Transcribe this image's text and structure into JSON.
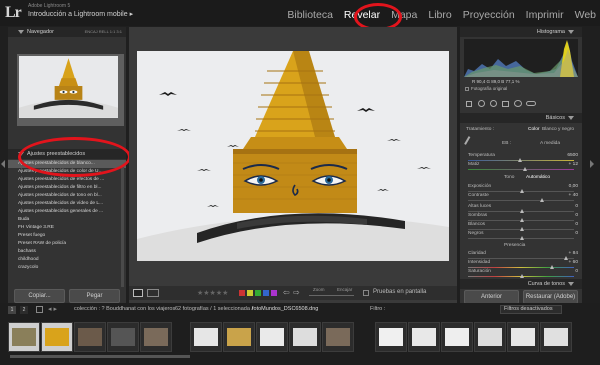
{
  "header": {
    "logo": "Lr",
    "app_subtitle": "Adobe Lightroom 5",
    "catalog_title": "Introducción a Lightroom mobile",
    "modules": [
      {
        "label": "Biblioteca"
      },
      {
        "label": "Revelar",
        "active": true
      },
      {
        "label": "Mapa"
      },
      {
        "label": "Libro"
      },
      {
        "label": "Proyección"
      },
      {
        "label": "Imprimir"
      },
      {
        "label": "Web"
      }
    ]
  },
  "left": {
    "navigator_title": "Navegador",
    "navigator_opts": "ENCAJ   RELL   1:1   3:1",
    "presets_title": "Ajustes preestablecidos",
    "presets": [
      "Ajustes preestablecidos de blanco...",
      "Ajustes preestablecidos de color de U...",
      "Ajustes preestablecidos de efectos de ...",
      "Ajustes preestablecidos de filtro en bl...",
      "Ajustes preestablecidos de tono en bl...",
      "Ajustes preestablecidos de vídeo de L...",
      "Ajustes preestablecidos generales de ...",
      "Buda",
      "FH Vintage 3.RE",
      "Preset fuego",
      "Preset RAW de policía",
      "bachass",
      "childhood",
      "crazycolo"
    ],
    "copy_label": "Copiar...",
    "paste_label": "Pegar"
  },
  "toolbar": {
    "zoom_label": "Zoom",
    "zoom_value": "Encajar",
    "preview_label": "Pruebas en pantalla"
  },
  "right": {
    "histogram_title": "Histograma",
    "readout": "R  90,4  G  89,0  B  77,1 %",
    "original_photo": "Fotografía original",
    "basic_title": "Básicos",
    "treatment_label": "Tratamiento :",
    "treatment_color": "Color",
    "treatment_bw": "Blanco y negro",
    "wb_label": "EB :",
    "wb_value": "A medida",
    "rows_wb": [
      {
        "label": "Temperatura",
        "value": "6500"
      },
      {
        "label": "Matiz",
        "value": "+ 12"
      }
    ],
    "tone_label": "Tono",
    "tone_auto": "Automático",
    "rows_tone": [
      {
        "label": "Exposición",
        "value": "0,00"
      },
      {
        "label": "Contraste",
        "value": "+ 40"
      }
    ],
    "rows_light": [
      {
        "label": "Altas luces",
        "value": "0"
      },
      {
        "label": "Sombras",
        "value": "0"
      },
      {
        "label": "Blancos",
        "value": "0"
      },
      {
        "label": "Negros",
        "value": "0"
      }
    ],
    "presence_title": "Presencia",
    "rows_presence": [
      {
        "label": "Claridad",
        "value": "+ 84"
      },
      {
        "label": "Intensidad",
        "value": "+ 60"
      },
      {
        "label": "Saturación",
        "value": "0"
      }
    ],
    "curve_title": "Curva de tonos",
    "previous_label": "Anterior",
    "reset_label": "Restaurar (Adobe)"
  },
  "filmstrip": {
    "page1": "1",
    "page2": "2",
    "source": "colección : ? Bouddhanat con los viajeros",
    "count": "62 fotografías / 1 seleccionada /",
    "filename": "fotoMundos_DSC6508.dng",
    "filter_label": "Filtro :",
    "filter_value": "Filtros desactivados"
  },
  "colors": {
    "accent_red": "#e2141c",
    "panel_bg": "#333333"
  }
}
